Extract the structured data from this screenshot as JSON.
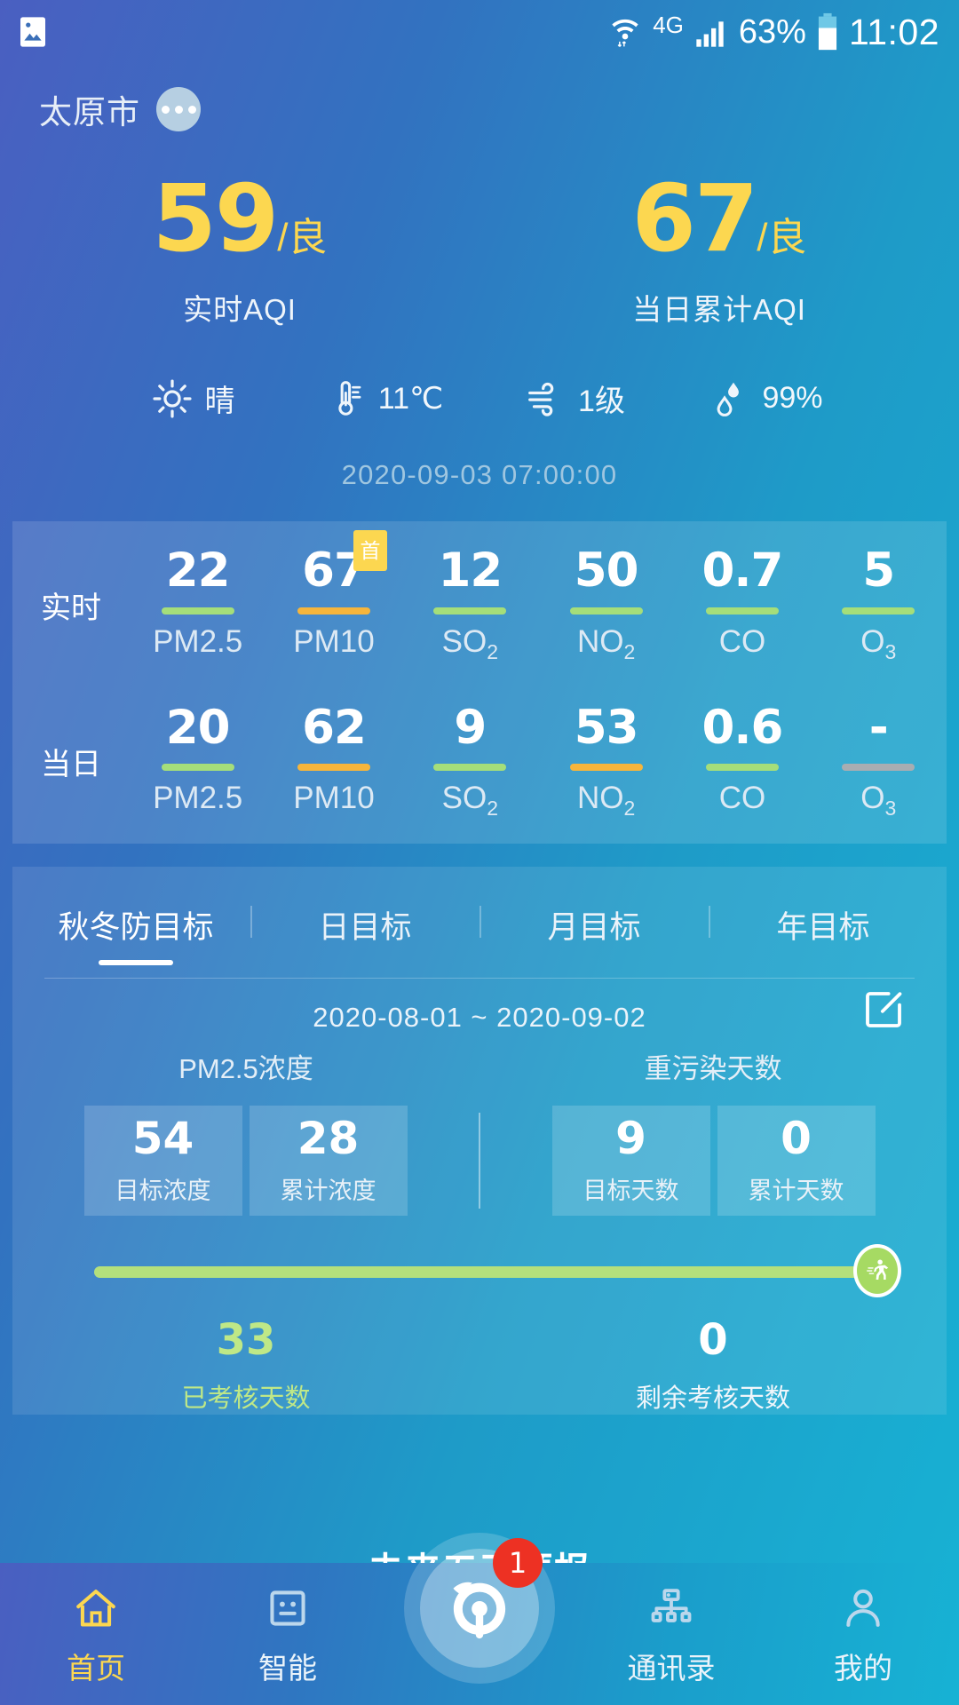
{
  "status_bar": {
    "left_icon": "photo-icon",
    "network_type": "4G",
    "battery_percent": "63%",
    "time": "11:02",
    "icons": [
      "wifi-icon",
      "signal-icon",
      "battery-icon"
    ]
  },
  "header": {
    "city": "太原市",
    "more_icon": "more-dots-icon"
  },
  "aqi": {
    "realtime": {
      "value": "59",
      "suffix": "/良",
      "label": "实时AQI"
    },
    "daily": {
      "value": "67",
      "suffix": "/良",
      "label": "当日累计AQI"
    },
    "accent_color": "#fcd750"
  },
  "weather": {
    "items": [
      {
        "icon": "sun-icon",
        "text": "晴"
      },
      {
        "icon": "thermometer-icon",
        "text": "11℃"
      },
      {
        "icon": "wind-icon",
        "text": "1级"
      },
      {
        "icon": "humidity-icon",
        "text": "99%"
      }
    ],
    "timestamp": "2020-09-03 07:00:00"
  },
  "pollutants": {
    "rows": [
      {
        "label": "实时",
        "cells": [
          {
            "value": "22",
            "name": "PM2.5",
            "sub": "",
            "bar_color": "#a5de7a",
            "badge": ""
          },
          {
            "value": "67",
            "name": "PM10",
            "sub": "",
            "bar_color": "#f6b53c",
            "badge": "首"
          },
          {
            "value": "12",
            "name": "SO",
            "sub": "2",
            "bar_color": "#a5de7a",
            "badge": ""
          },
          {
            "value": "50",
            "name": "NO",
            "sub": "2",
            "bar_color": "#a5de7a",
            "badge": ""
          },
          {
            "value": "0.7",
            "name": "CO",
            "sub": "",
            "bar_color": "#a5de7a",
            "badge": ""
          },
          {
            "value": "5",
            "name": "O",
            "sub": "3",
            "bar_color": "#a5de7a",
            "badge": ""
          }
        ]
      },
      {
        "label": "当日",
        "cells": [
          {
            "value": "20",
            "name": "PM2.5",
            "sub": "",
            "bar_color": "#a5de7a",
            "badge": ""
          },
          {
            "value": "62",
            "name": "PM10",
            "sub": "",
            "bar_color": "#f6b53c",
            "badge": ""
          },
          {
            "value": "9",
            "name": "SO",
            "sub": "2",
            "bar_color": "#a5de7a",
            "badge": ""
          },
          {
            "value": "53",
            "name": "NO",
            "sub": "2",
            "bar_color": "#f6b53c",
            "badge": ""
          },
          {
            "value": "0.6",
            "name": "CO",
            "sub": "",
            "bar_color": "#a5de7a",
            "badge": ""
          },
          {
            "value": "-",
            "name": "O",
            "sub": "3",
            "bar_color": "#a8adb2",
            "badge": ""
          }
        ]
      }
    ]
  },
  "goals": {
    "tabs": [
      {
        "label": "秋冬防目标",
        "active": true
      },
      {
        "label": "日目标",
        "active": false
      },
      {
        "label": "月目标",
        "active": false
      },
      {
        "label": "年目标",
        "active": false
      }
    ],
    "date_range": "2020-08-01 ~ 2020-09-02",
    "edit_icon": "edit-square-icon",
    "group_titles": {
      "left": "PM2.5浓度",
      "right": "重污染天数"
    },
    "metrics": [
      {
        "value": "54",
        "caption": "目标浓度"
      },
      {
        "value": "28",
        "caption": "累计浓度"
      },
      {
        "value": "9",
        "caption": "目标天数"
      },
      {
        "value": "0",
        "caption": "累计天数"
      }
    ],
    "progress": {
      "percent": 100,
      "fill_color": "#b4e07c",
      "knob_icon": "runner-icon"
    },
    "days": [
      {
        "value": "33",
        "caption": "已考核天数",
        "color": "#bfe887"
      },
      {
        "value": "0",
        "caption": "剩余考核天数",
        "color": "#ffffff"
      }
    ]
  },
  "forecast": {
    "title": "未来五天预报"
  },
  "bottom_nav": {
    "items": [
      {
        "label": "首页",
        "icon": "home-icon",
        "active": true
      },
      {
        "label": "智能",
        "icon": "robot-icon",
        "active": false
      },
      {
        "label": "通讯录",
        "icon": "orgchart-icon",
        "active": false
      },
      {
        "label": "我的",
        "icon": "person-icon",
        "active": false
      }
    ],
    "fab": {
      "icon": "owl-logo-icon",
      "badge": "1",
      "badge_color": "#ed3123"
    }
  }
}
